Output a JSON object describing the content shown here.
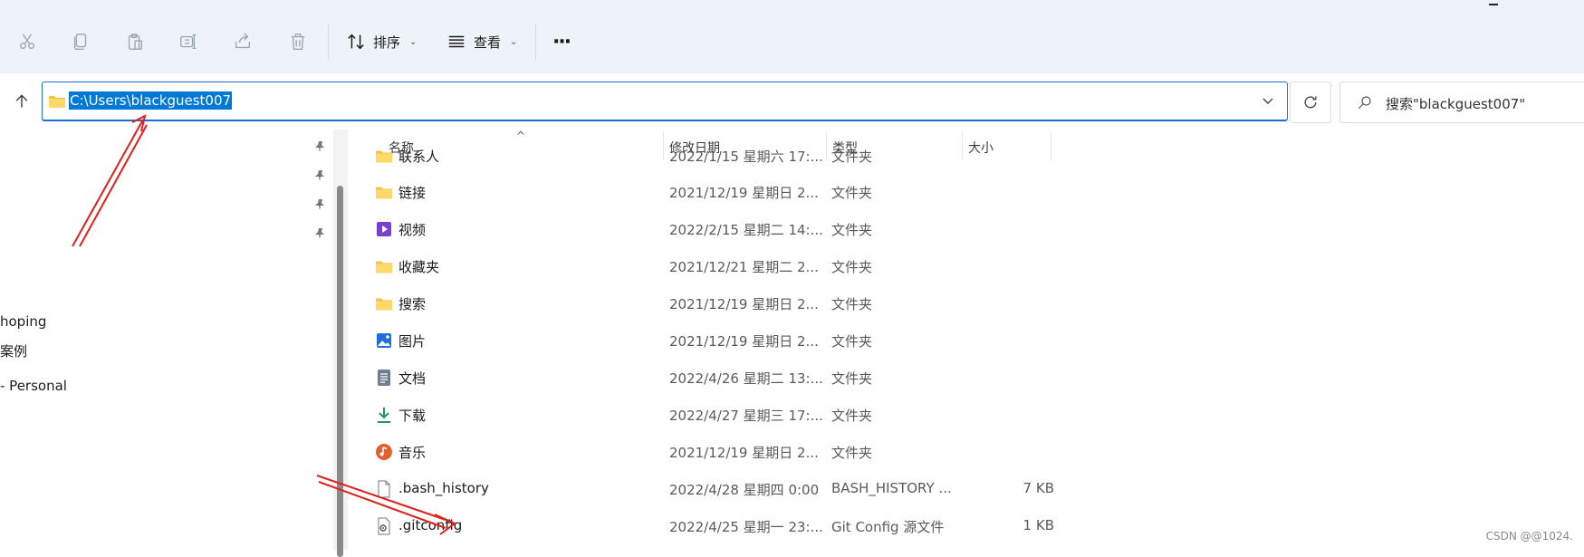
{
  "toolbar": {
    "cut_icon": "scissors-icon",
    "copy_icon": "copy-icon",
    "paste_icon": "clipboard-icon",
    "rename_icon": "rename-icon",
    "share_icon": "share-icon",
    "delete_icon": "trash-icon",
    "sort_label": "排序",
    "view_label": "查看",
    "more_label": "···"
  },
  "address": {
    "path": "C:\\Users\\blackguest007"
  },
  "search": {
    "placeholder": "搜索\"blackguest007\""
  },
  "sidebar": {
    "items": [
      {
        "label": "hoping"
      },
      {
        "label": "案例"
      },
      {
        "label": "- Personal"
      }
    ]
  },
  "columns": {
    "name": "名称",
    "date": "修改日期",
    "type": "类型",
    "size": "大小"
  },
  "files": [
    {
      "name": "联系人",
      "date": "2022/1/15 星期六 17:...",
      "type": "文件夹",
      "size": "",
      "icon": "folder-icon"
    },
    {
      "name": "链接",
      "date": "2021/12/19 星期日 2...",
      "type": "文件夹",
      "size": "",
      "icon": "folder-icon"
    },
    {
      "name": "视频",
      "date": "2022/2/15 星期二 14:...",
      "type": "文件夹",
      "size": "",
      "icon": "video-folder-icon"
    },
    {
      "name": "收藏夹",
      "date": "2021/12/21 星期二 2...",
      "type": "文件夹",
      "size": "",
      "icon": "folder-icon"
    },
    {
      "name": "搜索",
      "date": "2021/12/19 星期日 2...",
      "type": "文件夹",
      "size": "",
      "icon": "folder-icon"
    },
    {
      "name": "图片",
      "date": "2021/12/19 星期日 2...",
      "type": "文件夹",
      "size": "",
      "icon": "pictures-icon"
    },
    {
      "name": "文档",
      "date": "2022/4/26 星期二 13:...",
      "type": "文件夹",
      "size": "",
      "icon": "documents-icon"
    },
    {
      "name": "下载",
      "date": "2022/4/27 星期三 17:...",
      "type": "文件夹",
      "size": "",
      "icon": "download-icon"
    },
    {
      "name": "音乐",
      "date": "2021/12/19 星期日 2...",
      "type": "文件夹",
      "size": "",
      "icon": "music-icon"
    },
    {
      "name": ".bash_history",
      "date": "2022/4/28 星期四 0:00",
      "type": "BASH_HISTORY ...",
      "size": "7 KB",
      "icon": "file-icon"
    },
    {
      "name": ".gitconfig",
      "date": "2022/4/25 星期一 23:...",
      "type": "Git Config 源文件",
      "size": "1 KB",
      "icon": "config-file-icon"
    }
  ],
  "watermark": "CSDN @@1024.",
  "colors": {
    "accent": "#0078d7",
    "annotation": "#e0201e",
    "toolbar_bg": "#eef3f9"
  }
}
